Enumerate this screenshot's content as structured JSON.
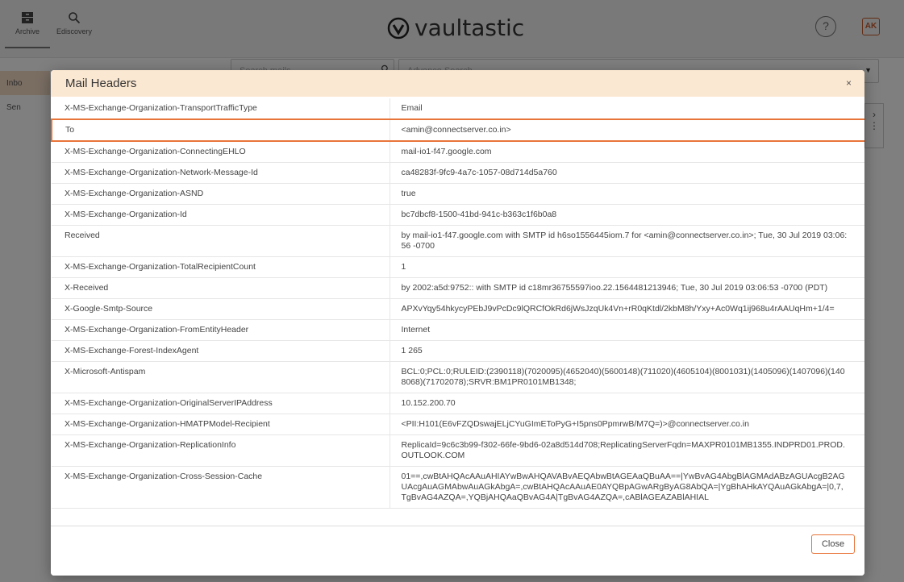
{
  "app": {
    "brand": "vaultastic",
    "nav": [
      {
        "label": "Archive",
        "icon": "archive-icon",
        "active": true
      },
      {
        "label": "Ediscovery",
        "icon": "search-icon",
        "active": false
      }
    ],
    "help_label": "?",
    "avatar_initials": "AK"
  },
  "toolbar": {
    "search_placeholder": "Search mails",
    "advance_search_placeholder": "Advance Search"
  },
  "sidebar": {
    "items": [
      {
        "label": "Inbo"
      },
      {
        "label": "Sen"
      }
    ]
  },
  "modal": {
    "title": "Mail Headers",
    "close_icon": "×",
    "highlight_color": "#e8743a",
    "close_button": "Close",
    "rows": [
      {
        "key": "X-MS-Exchange-Organization-TransportTrafficType",
        "value": "Email"
      },
      {
        "key": "To",
        "value": "<amin@connectserver.co.in>",
        "highlighted": true
      },
      {
        "key": "X-MS-Exchange-Organization-ConnectingEHLO",
        "value": "mail-io1-f47.google.com"
      },
      {
        "key": "X-MS-Exchange-Organization-Network-Message-Id",
        "value": "ca48283f-9fc9-4a7c-1057-08d714d5a760"
      },
      {
        "key": "X-MS-Exchange-Organization-ASND",
        "value": "true"
      },
      {
        "key": "X-MS-Exchange-Organization-Id",
        "value": "bc7dbcf8-1500-41bd-941c-b363c1f6b0a8"
      },
      {
        "key": "Received",
        "value": "by mail-io1-f47.google.com with SMTP id h6so1556445iom.7 for <amin@connectserver.co.in>; Tue, 30 Jul 2019 03:06:56 -0700"
      },
      {
        "key": "X-MS-Exchange-Organization-TotalRecipientCount",
        "value": "1"
      },
      {
        "key": "X-Received",
        "value": "by 2002:a5d:9752:: with SMTP id c18mr36755597ioo.22.1564481213946; Tue, 30 Jul 2019 03:06:53 -0700 (PDT)"
      },
      {
        "key": "X-Google-Smtp-Source",
        "value": "APXvYqy54hkycyPEbJ9vPcDc9lQRCfOkRd6jWsJzqUk4Vn+rR0qKtdl/2kbM8h/Yxy+Ac0Wq1ij968u4rAAUqHm+1/4="
      },
      {
        "key": "X-MS-Exchange-Organization-FromEntityHeader",
        "value": "Internet"
      },
      {
        "key": "X-MS-Exchange-Forest-IndexAgent",
        "value": "1 265"
      },
      {
        "key": "X-Microsoft-Antispam",
        "value": "BCL:0;PCL:0;RULEID:(2390118)(7020095)(4652040)(5600148)(711020)(4605104)(8001031)(1405096)(1407096)(1408068)(71702078);SRVR:BM1PR0101MB1348;"
      },
      {
        "key": "X-MS-Exchange-Organization-OriginalServerIPAddress",
        "value": "10.152.200.70"
      },
      {
        "key": "X-MS-Exchange-Organization-HMATPModel-Recipient",
        "value": "<PII:H101(E6vFZQDswajELjCYuGImEToPyG+I5pns0PpmrwB/M7Q=)>@connectserver.co.in"
      },
      {
        "key": "X-MS-Exchange-Organization-ReplicationInfo",
        "value": "ReplicaId=9c6c3b99-f302-66fe-9bd6-02a8d514d708;ReplicatingServerFqdn=MAXPR0101MB1355.INDPRD01.PROD.OUTLOOK.COM"
      },
      {
        "key": "X-MS-Exchange-Organization-Cross-Session-Cache",
        "value": "01==,cwBtAHQAcAAuAHIAYwBwAHQAVABvAEQAbwBtAGEAaQBuAA==|YwBvAG4AbgBlAGMAdABzAGUAcgB2AGUAcgAuAGMAbwAuAGkAbgA=,cwBtAHQAcAAuAE0AYQBpAGwARgByAG8AbQA=|YgBhAHkAYQAuAGkAbgA=|0,7,TgBvAG4AZQA=,YQBjAHQAaQBvAG4A|TgBvAG4AZQA=,cABlAGEAZABlAHIAL"
      }
    ]
  }
}
